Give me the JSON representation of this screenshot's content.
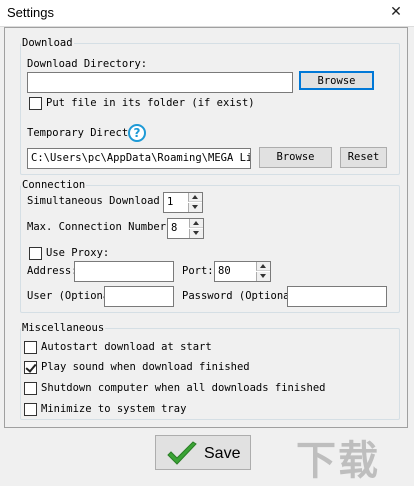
{
  "window": {
    "title": "Settings",
    "close_glyph": "✕"
  },
  "download": {
    "legend": "Download",
    "directory_label": "Download Directory:",
    "directory_value": "",
    "browse_label": "Browse",
    "put_in_folder_label": "Put file in its folder (if exist)",
    "put_in_folder_checked": false,
    "temp_dir_label": "Temporary Directo",
    "help_glyph": "?",
    "temp_dir_value": "C:\\Users\\pc\\AppData\\Roaming\\MEGA Lin",
    "temp_browse_label": "Browse",
    "reset_label": "Reset"
  },
  "connection": {
    "legend": "Connection",
    "simultaneous_label": "Simultaneous Download",
    "simultaneous_value": "1",
    "max_conn_label": "Max. Connection Numbers",
    "max_conn_value": "8",
    "use_proxy_label": "Use Proxy:",
    "use_proxy_checked": false,
    "address_label": "Address:",
    "address_value": "",
    "port_label": "Port:",
    "port_value": "80",
    "user_label": "User (Optiona",
    "user_value": "",
    "password_label": "Password (Optional",
    "password_value": ""
  },
  "misc": {
    "legend": "Miscellaneous",
    "autostart_label": "Autostart download at start",
    "play_sound_label": "Play sound when download finished",
    "shutdown_label": "Shutdown computer when all downloads finished",
    "minimize_label": "Minimize to system tray"
  },
  "footer": {
    "save_label": "Save"
  },
  "colors": {
    "accent": "#0078d7",
    "check_green": "#3aa335",
    "help_blue": "#1e9ad6"
  },
  "watermark": {
    "glyphs": "下载"
  }
}
